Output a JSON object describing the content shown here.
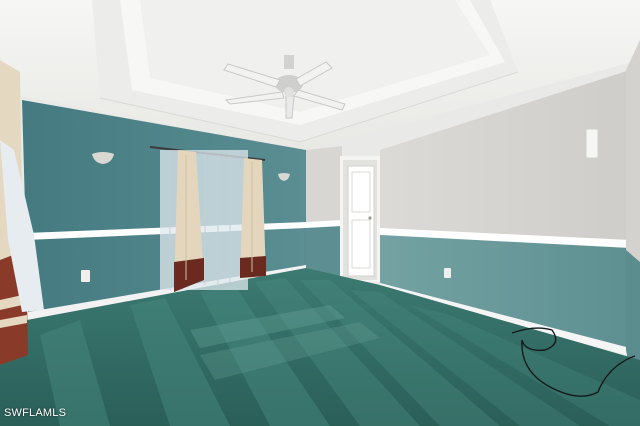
{
  "photo": {
    "watermark": "SWFLAMLS",
    "subject": "empty-bedroom",
    "colors": {
      "ceiling": "#f3f3f1",
      "wall_upper_blue": "#4f8489",
      "wall_lower_blue": "#5d8f92",
      "wall_upper_beige": "#d8d6d2",
      "wall_lower_beige_blue": "#6b9a9b",
      "carpet": "#2f6a63",
      "trim": "#ffffff",
      "curtain_cream": "#e3d6bd",
      "curtain_brown": "#6b2a1f",
      "sheer": "#dfe8ee"
    },
    "icons": {
      "ceiling_fan": "ceiling-fan-icon",
      "wall_sconce": "wall-sconce-icon",
      "outlet": "outlet-icon",
      "thermostat": "thermostat-icon"
    }
  }
}
